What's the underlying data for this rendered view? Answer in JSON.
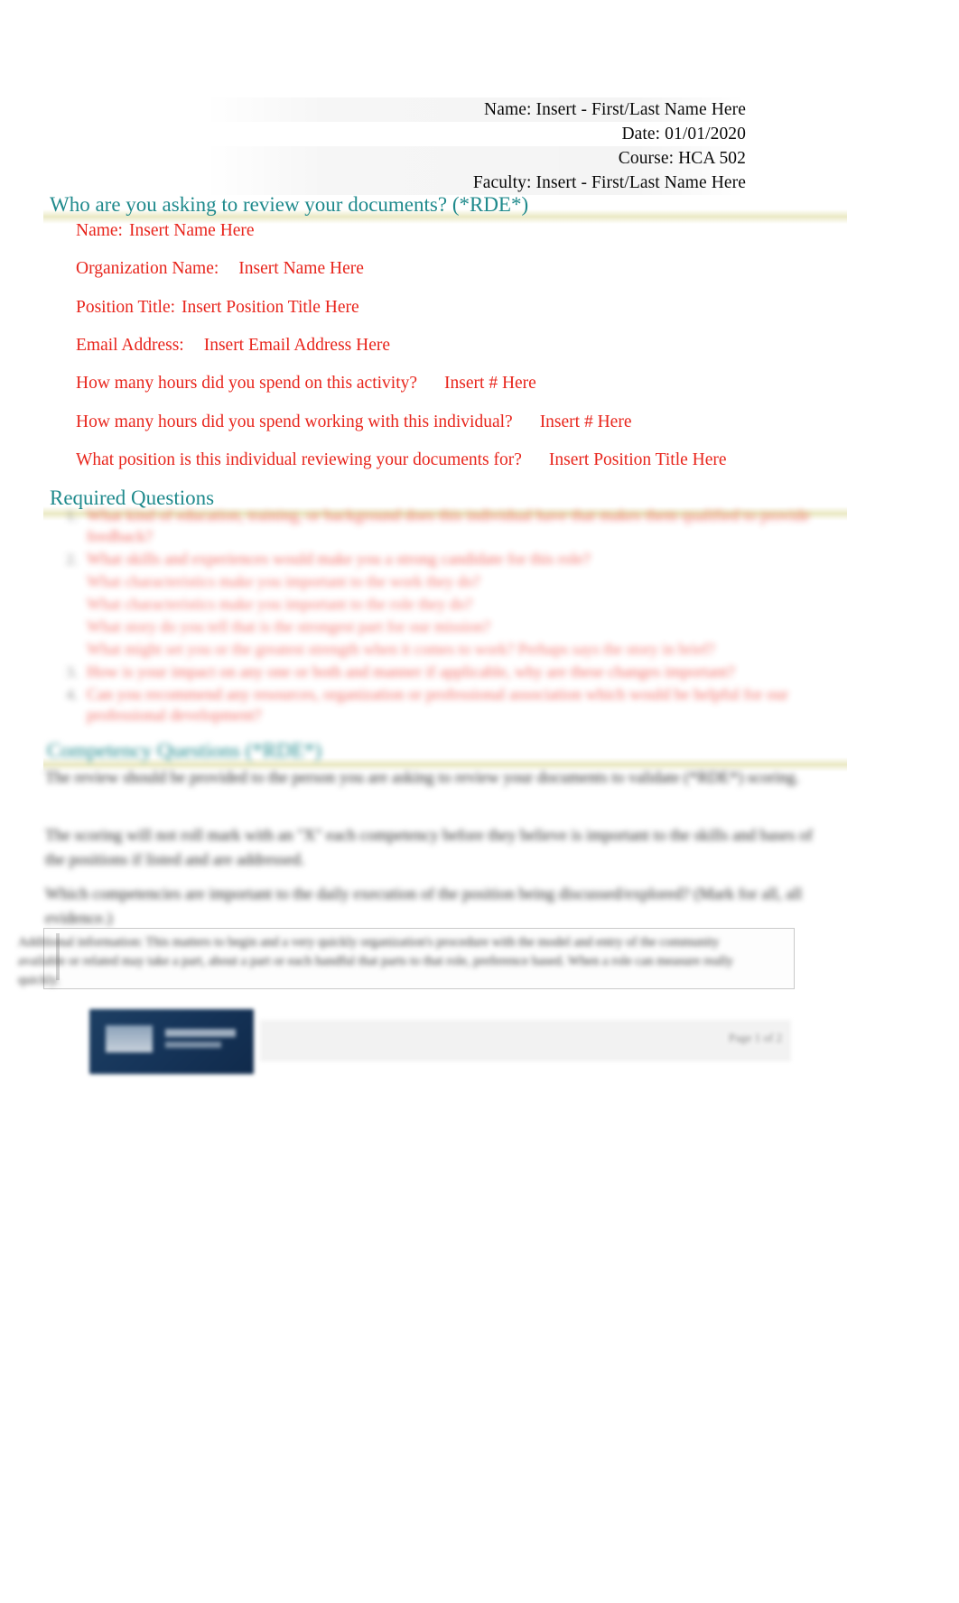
{
  "document": {
    "header": {
      "name_line": "Name: Insert - First/Last Name Here",
      "date_line": "Date: 01/01/2020",
      "course_line": "Course: HCA 502",
      "faculty_line": "Faculty: Insert - First/Last Name Here"
    },
    "section_rde": {
      "heading": "Who are you asking to review your documents? (*RDE*)",
      "fields": [
        {
          "label": "Name:",
          "value": "Insert Name Here"
        },
        {
          "label": "Organization Name:",
          "value": "Insert Name Here"
        },
        {
          "label": "Position Title:",
          "value": "Insert Position Title Here"
        },
        {
          "label": "Email Address:",
          "value": "Insert Email Address Here"
        },
        {
          "label": "How many hours did you spend on this activity?",
          "value": "Insert # Here"
        },
        {
          "label": "How many hours did you spend working with this individual?",
          "value": "Insert # Here"
        },
        {
          "label": "What position is this individual reviewing your documents for?",
          "value": "Insert Position Title Here"
        }
      ]
    },
    "section_required": {
      "heading": "Required Questions",
      "questions": [
        {
          "number": "1.",
          "text": "What kind of education, training, or background does this individual have that makes them qualified to provide feedback?",
          "subs": []
        },
        {
          "number": "2.",
          "text": "What skills and experiences would make you a strong candidate for this role?",
          "subs": [
            "What characteristics make you important to the work they do?",
            "What characteristics make you important to the role they do?",
            "What story do you tell that is the strongest part for our mission?",
            "What might set you or the greatest strength when it comes to work? Perhaps says the story in brief?"
          ]
        },
        {
          "number": "3.",
          "text": "How is your impact on any one or both and manner if applicable, why are these changes important?",
          "subs": []
        },
        {
          "number": "4.",
          "text": "Can you recommend any resources, organization or professional association which would be helpful for our professional development?",
          "subs": []
        }
      ]
    },
    "section_competency": {
      "heading": "Competency Questions (*RDE*)",
      "paragraphs": [
        "The review should be provided to the person you are asking to review your documents to validate (*RDE*) scoring.",
        "The scoring will not roll mark with an \"X\" each competency before they believe is important to the skills and bases of the positions if listed and are addressed.",
        "Which competencies are important to the daily execution of the position being discussed/explored? (Mark for all, all evidence.)",
        "Additional information: This matters to begin and a very quickly organization's procedure with the model and entry of the community available or related may take a part, about a part or each handful that parts to that role, preference based. When a role can measure really quickly."
      ],
      "footer": {
        "page_number": "Page 1 of 2"
      }
    }
  }
}
